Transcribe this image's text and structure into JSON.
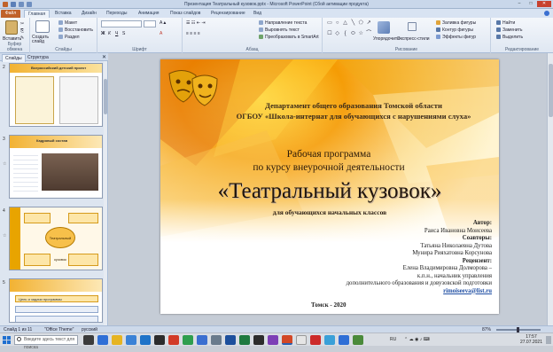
{
  "window": {
    "title": "Презентация Театральный кузовок.pptx - Microsoft PowerPoint (Сбой активации продукта)"
  },
  "ribbon_tabs": {
    "file": "Файл",
    "tabs": [
      "Главная",
      "Вставка",
      "Дизайн",
      "Переходы",
      "Анимация",
      "Показ слайдов",
      "Рецензирование",
      "Вид"
    ]
  },
  "ribbon": {
    "clipboard": {
      "paste": "Вставить",
      "group": "Буфер обмена"
    },
    "slides": {
      "new": "Создать слайд",
      "layout": "Макет",
      "reset": "Восстановить",
      "section": "Раздел",
      "group": "Слайды"
    },
    "font_group": "Шрифт",
    "paragraph": {
      "direction": "Направление текста",
      "align": "Выровнять текст",
      "smartart": "Преобразовать в SmartArt",
      "group": "Абзац"
    },
    "drawing": {
      "arrange": "Упорядочить",
      "quick_styles": "Экспресс-стили",
      "fill": "Заливка фигуры",
      "outline": "Контур фигуры",
      "effects": "Эффекты фигур",
      "group": "Рисование"
    },
    "editing": {
      "find": "Найти",
      "replace": "Заменить",
      "select": "Выделить",
      "group": "Редактирование"
    }
  },
  "panel": {
    "tab_slides": "Слайды",
    "tab_outline": "Структура",
    "thumbnails": [
      {
        "num": "2",
        "title": "Всероссийский детский проект"
      },
      {
        "num": "3",
        "title": "Кадровый состав"
      },
      {
        "num": "4",
        "title": "Театральный кузовок"
      },
      {
        "num": "5",
        "title": "Цель и задачи программы"
      }
    ]
  },
  "slide": {
    "dept_line1": "Департамент общего образования Томской области",
    "dept_line2": "ОГБОУ «Школа-интернат для обучающихся с нарушениями слуха»",
    "prog_line1": "Рабочая программа",
    "prog_line2": "по курсу внеурочной деятельности",
    "title": "«Театральный кузовок»",
    "subtitle": "для обучающихся начальных классов",
    "author_label": "Автор:",
    "author_name": "Раиса Ивановна  Моисеева",
    "coauthors_label": "Соавторы:",
    "coauthor1": "Татьяна Николаевна  Дутова",
    "coauthor2": "Мунира  Рияхатовна Корсунова",
    "reviewer_label": "Рецензент:",
    "reviewer_name": "Елена Владимировна  Долморова –",
    "reviewer_title1": "к.п.н., начальник  управления",
    "reviewer_title2": "дополнительного  образования и довузовской подготовки",
    "email": "rimoiseeva@list.ru",
    "city_year": "Томск - 2020"
  },
  "status": {
    "slide_of": "Слайд 1 из 11",
    "theme": "\"Office Theme\"",
    "lang": "русский",
    "zoom": "87%"
  },
  "taskbar": {
    "search_placeholder": "Введите здесь текст для поиска",
    "lang": "RU",
    "time": "17:57",
    "date": "27.07.2021"
  },
  "colors": {
    "accent": "#c0622a",
    "slide_flame": "#f08a00",
    "email": "#1f4ea3"
  }
}
